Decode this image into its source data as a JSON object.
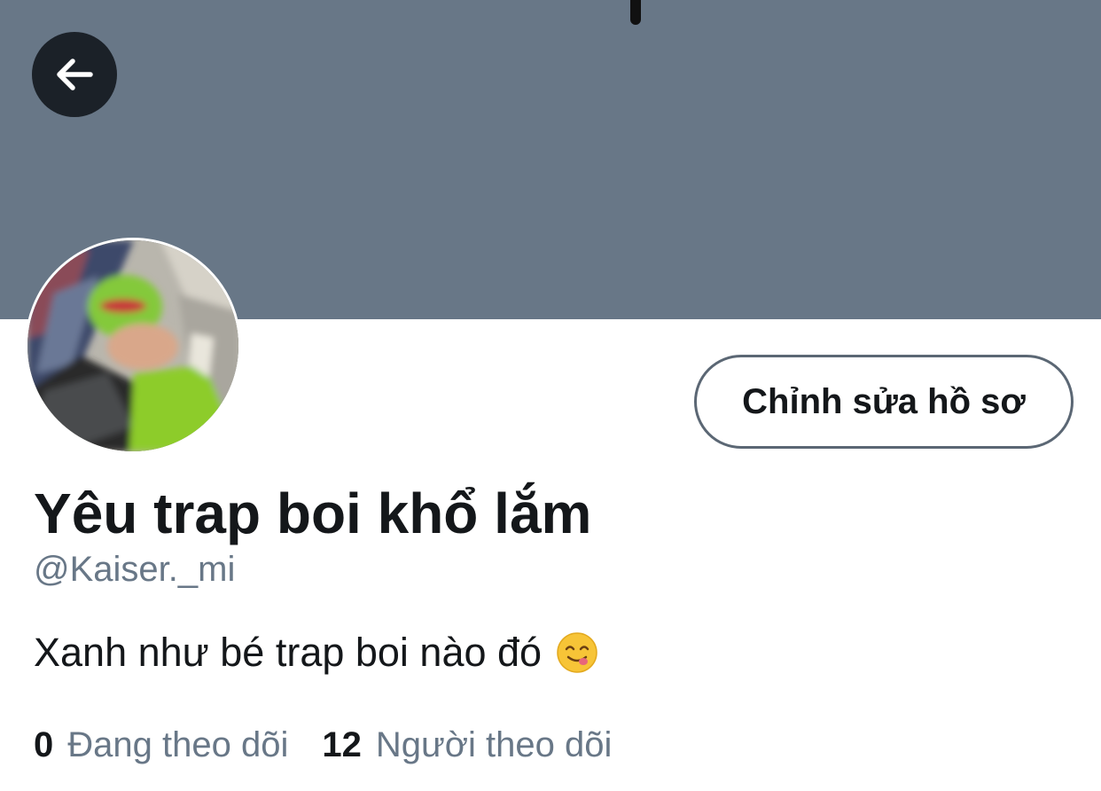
{
  "profile": {
    "display_name": "Yêu trap boi khổ lắm",
    "handle": "@Kaiser._mi",
    "bio_text": "Xanh như bé trap boi nào đó",
    "bio_emoji": "face-savoring-food-emoji"
  },
  "actions": {
    "edit_profile_label": "Chỉnh sửa hồ sơ",
    "back_icon": "arrow-left-icon"
  },
  "stats": {
    "following_count": "0",
    "following_label": "Đang theo dõi",
    "followers_count": "12",
    "followers_label": "Người theo dõi"
  },
  "colors": {
    "banner": "#687787",
    "text_primary": "#14171a",
    "text_secondary": "#687787",
    "back_button_bg": "#1b2128"
  }
}
